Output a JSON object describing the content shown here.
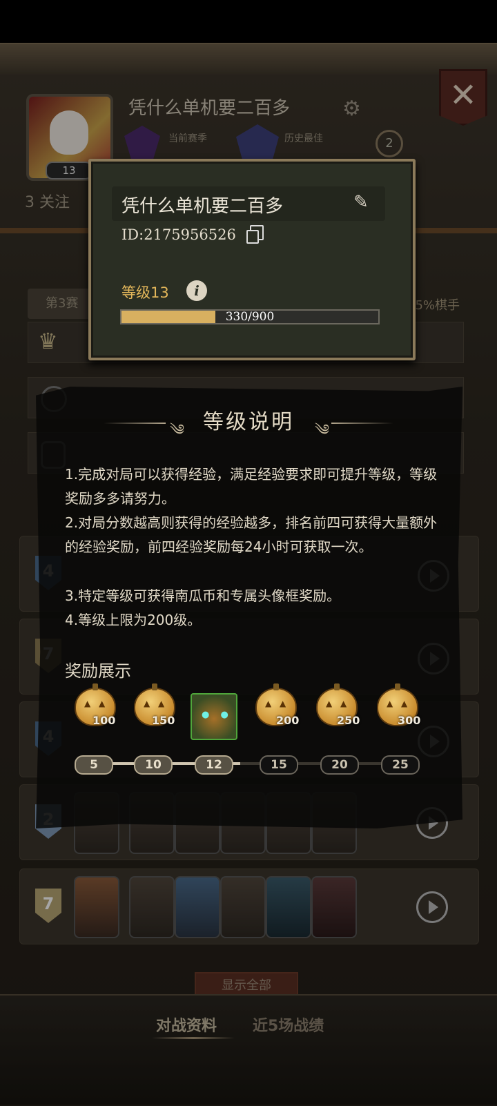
{
  "profile": {
    "name": "凭什么单机要二百多",
    "level_badge": "13",
    "current_season_label": "当前赛季",
    "best_label": "历史最佳",
    "small_badge": "2",
    "follow": "3 关注"
  },
  "tabs": {
    "season": "第3赛",
    "percent": "35%棋手"
  },
  "show_all": "显示全部",
  "bottom_tabs": [
    "对战资料",
    "近5场战绩"
  ],
  "match_ranks": [
    "4",
    "7",
    "4",
    "2",
    "7"
  ],
  "explain": {
    "title": "等级说明",
    "rules": [
      "1.完成对局可以获得经验，满足经验要求即可提升等级，等级奖励多多请努力。",
      "2.对局分数越高则获得的经验越多，排名前四可获得大量额外的经验奖励，前四经验奖励每24小时可获取一次。",
      "3.特定等级可获得南瓜币和专属头像框奖励。",
      "4.等级上限为200级。"
    ],
    "rewards_title": "奖励展示",
    "rewards": [
      {
        "type": "pumpkin-coin",
        "value": "100",
        "level": "5",
        "reached": true
      },
      {
        "type": "pumpkin-coin",
        "value": "150",
        "level": "10",
        "reached": true
      },
      {
        "type": "avatar-frame",
        "value": "",
        "level": "12",
        "reached": true
      },
      {
        "type": "pumpkin-coin",
        "value": "200",
        "level": "15",
        "reached": false
      },
      {
        "type": "pumpkin-coin",
        "value": "250",
        "level": "20",
        "reached": false
      },
      {
        "type": "pumpkin-coin",
        "value": "300",
        "level": "25",
        "reached": false
      }
    ]
  },
  "popup": {
    "name": "凭什么单机要二百多",
    "id_text": "ID:2175956526",
    "level_text": "等级13",
    "exp_current": 330,
    "exp_max": 900,
    "exp_text": "330/900"
  },
  "colors": {
    "accent_gold": "#d8b060",
    "level_text": "#e2b65a",
    "popup_border": "#8b7a5a",
    "close_button": "#5a2a22"
  }
}
